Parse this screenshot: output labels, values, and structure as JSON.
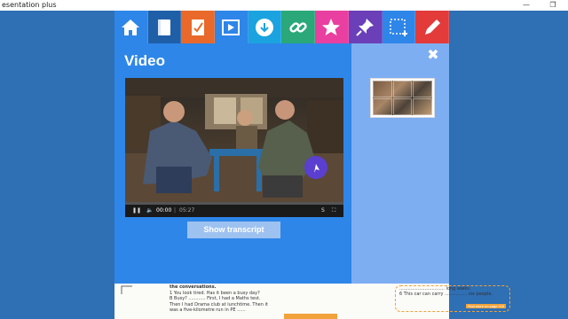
{
  "window": {
    "title": "esentation plus",
    "minimize_glyph": "—",
    "maximize_glyph": "❐"
  },
  "toolbar": {
    "tools": [
      {
        "name": "home",
        "icon": "home-icon",
        "color": "#2e86e8"
      },
      {
        "name": "book",
        "icon": "book-icon",
        "color": "#1f5fa8"
      },
      {
        "name": "exercise",
        "icon": "checklist-icon",
        "color": "#e8692a"
      },
      {
        "name": "video",
        "icon": "play-icon",
        "color": "#2e86e8"
      },
      {
        "name": "download",
        "icon": "cloud-download-icon",
        "color": "#1aa3de"
      },
      {
        "name": "link",
        "icon": "link-icon",
        "color": "#2aa87a"
      },
      {
        "name": "favourite",
        "icon": "star-icon",
        "color": "#e83fa0"
      },
      {
        "name": "pin",
        "icon": "pin-icon",
        "color": "#6a3fb8"
      },
      {
        "name": "select",
        "icon": "selection-icon",
        "color": "#2e86e8"
      },
      {
        "name": "pen",
        "icon": "pen-icon",
        "color": "#e33a3a"
      }
    ]
  },
  "panel": {
    "heading": "Video",
    "transcript_button": "Show transcript"
  },
  "player": {
    "current_time": "00:00",
    "duration": "05:27",
    "progress": 0,
    "subtitle_label": "S"
  },
  "book_page": {
    "left_lines": [
      "the conversations.",
      "1  You look tired. Has it been a busy day?",
      "B  Busy? ............ First, I had a Maths test.",
      "   Then I had Drama club at lunchtime. Then it",
      "   was a five-kilometre run in PE ......"
    ],
    "right_lines": [
      "................................ long walks.",
      "6  This car can carry ................ six people."
    ],
    "box_label": "Find more on page 116"
  },
  "colors": {
    "main_panel": "#2e86e8",
    "side_panel": "#7eaef2",
    "transcript_button": "#9ec2f0"
  }
}
